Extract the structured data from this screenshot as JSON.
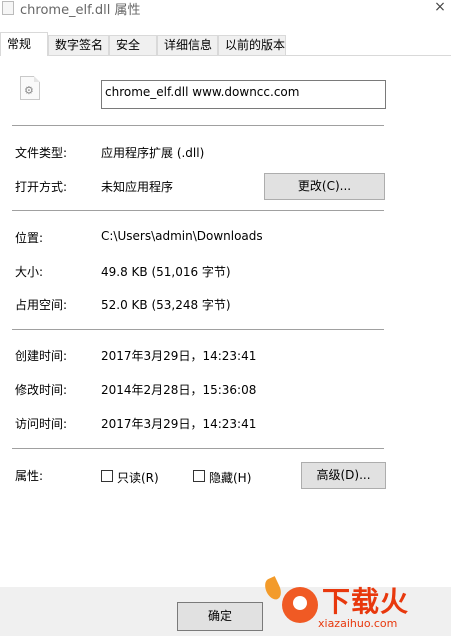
{
  "window": {
    "title": "chrome_elf.dll 属性",
    "close_glyph": "×"
  },
  "tabs": [
    {
      "label": "常规",
      "active": true
    },
    {
      "label": "数字签名",
      "active": false
    },
    {
      "label": "安全",
      "active": false
    },
    {
      "label": "详细信息",
      "active": false
    },
    {
      "label": "以前的版本",
      "active": false
    }
  ],
  "file": {
    "icon": "dll-file-icon",
    "name": "chrome_elf.dll      www.downcc.com"
  },
  "type_section": {
    "file_type_label": "文件类型:",
    "file_type_value": "应用程序扩展 (.dll)",
    "opens_with_label": "打开方式:",
    "opens_with_value": "未知应用程序",
    "change_button": "更改(C)..."
  },
  "location_section": {
    "location_label": "位置:",
    "location_value": "C:\\Users\\admin\\Downloads",
    "size_label": "大小:",
    "size_value": "49.8 KB (51,016 字节)",
    "size_on_disk_label": "占用空间:",
    "size_on_disk_value": "52.0 KB (53,248 字节)"
  },
  "dates_section": {
    "created_label": "创建时间:",
    "created_value": "2017年3月29日，14:23:41",
    "modified_label": "修改时间:",
    "modified_value": "2014年2月28日，15:36:08",
    "accessed_label": "访问时间:",
    "accessed_value": "2017年3月29日，14:23:41"
  },
  "attributes": {
    "label": "属性:",
    "readonly_label": "只读(R)",
    "readonly_checked": false,
    "hidden_label": "隐藏(H)",
    "hidden_checked": false,
    "advanced_button": "高级(D)..."
  },
  "footer": {
    "ok_button": "确定"
  },
  "watermark": {
    "brand": "下载火",
    "site": "xiazaihuo.com",
    "colors": {
      "primary": "#e8380d",
      "flame": "#f39b2a"
    }
  }
}
